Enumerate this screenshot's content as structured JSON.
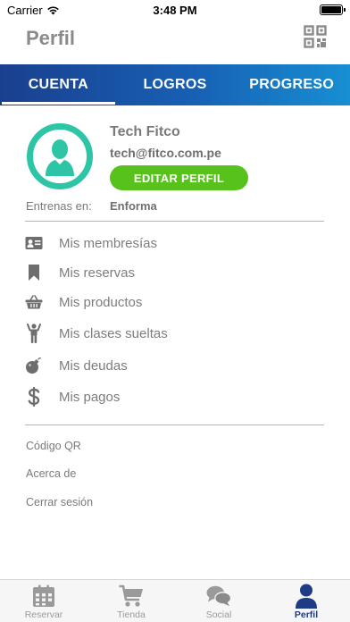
{
  "status_bar": {
    "carrier": "Carrier",
    "time": "3:48 PM"
  },
  "header": {
    "title": "Perfil",
    "qr_icon": "qr-code-icon"
  },
  "tabs": [
    {
      "label": "CUENTA",
      "active": true
    },
    {
      "label": "LOGROS",
      "active": false
    },
    {
      "label": "PROGRESO",
      "active": false
    }
  ],
  "profile": {
    "name": "Tech Fitco",
    "email": "tech@fitco.com.pe",
    "edit_button": "EDITAR PERFIL",
    "train_label": "Entrenas en:",
    "train_value": "Enforma"
  },
  "menu": [
    {
      "label": "Mis membresías",
      "icon": "id-card-icon"
    },
    {
      "label": "Mis reservas",
      "icon": "bookmark-icon"
    },
    {
      "label": "Mis productos",
      "icon": "basket-icon"
    },
    {
      "label": "Mis clases sueltas",
      "icon": "person-arms-up-icon"
    },
    {
      "label": "Mis deudas",
      "icon": "bomb-icon"
    },
    {
      "label": "Mis pagos",
      "icon": "dollar-icon"
    }
  ],
  "links": [
    {
      "label": "Código QR"
    },
    {
      "label": "Acerca de"
    },
    {
      "label": "Cerrar sesión"
    }
  ],
  "tabbar": [
    {
      "label": "Reservar",
      "icon": "calendar-icon",
      "active": false
    },
    {
      "label": "Tienda",
      "icon": "cart-icon",
      "active": false
    },
    {
      "label": "Social",
      "icon": "chat-bubbles-icon",
      "active": false
    },
    {
      "label": "Perfil",
      "icon": "user-icon",
      "active": true
    }
  ],
  "colors": {
    "accent_green": "#58c21d",
    "avatar_teal": "#2ec4a6",
    "tab_gradient_start": "#1a3f8f",
    "tab_gradient_end": "#178fd2",
    "tabbar_active": "#1d3b86"
  }
}
